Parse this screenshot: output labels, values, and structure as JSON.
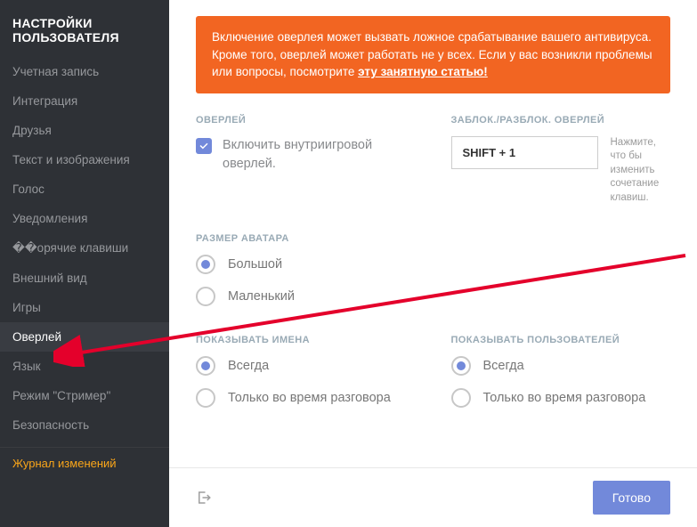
{
  "sidebar": {
    "title": "НАСТРОЙКИ ПОЛЬЗОВАТЕЛЯ",
    "items": [
      "Учетная запись",
      "Интеграция",
      "Друзья",
      "Текст и изображения",
      "Голос",
      "Уведомления",
      "��орячие клавиши",
      "Внешний вид",
      "Игры",
      "Оверлей",
      "Язык",
      "Режим \"Стример\"",
      "Безопасность"
    ],
    "active_index": 9,
    "changelog": "Журнал изменений"
  },
  "warning": {
    "text_prefix": "Включение оверлея может вызвать ложное срабатывание вашего антивируса. Кроме того, оверлей может работать не у всех. Если у вас возникли проблемы или вопросы, посмотрите ",
    "link": "эту занятную статью!"
  },
  "overlay_section": {
    "label": "ОВЕРЛЕЙ",
    "checkbox_label": "Включить внутриигровой оверлей."
  },
  "keybind_section": {
    "label": "ЗАБЛОК./РАЗБЛОК. ОВЕРЛЕЙ",
    "value": "SHIFT + 1",
    "hint": "Нажмите, что бы изменить сочетание клавиш."
  },
  "avatar_size": {
    "label": "РАЗМЕР АВАТАРА",
    "options": [
      "Большой",
      "Маленький"
    ],
    "selected": 0
  },
  "show_names": {
    "label": "ПОКАЗЫВАТЬ ИМЕНА",
    "options": [
      "Всегда",
      "Только во время разговора"
    ],
    "selected": 0
  },
  "show_users": {
    "label": "ПОКАЗЫВАТЬ ПОЛЬЗОВАТЕЛЕЙ",
    "options": [
      "Всегда",
      "Только во время разговора"
    ],
    "selected": 0
  },
  "footer": {
    "done": "Готово"
  }
}
